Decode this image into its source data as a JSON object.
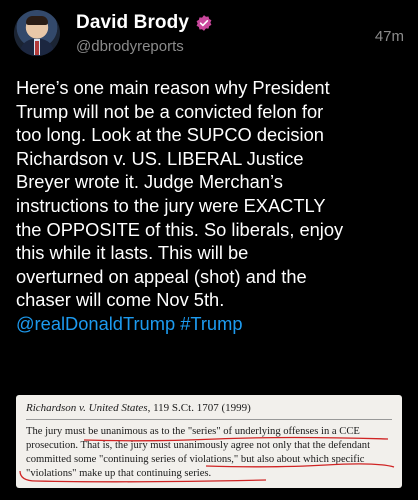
{
  "author": {
    "name": "David Brody",
    "handle": "@dbrodyreports",
    "time": "47m"
  },
  "post": {
    "text": "Here’s one main reason why President\nTrump will not be a convicted felon for\ntoo long. Look at the SUPCO decision\nRichardson v. US. LIBERAL Justice\nBreyer wrote it. Judge Merchan’s\ninstructions to the jury were EXACTLY\nthe OPPOSITE of this. So liberals, enjoy\nthis while it lasts. This will be\noverturned on appeal (shot) and the\nchaser will come Nov 5th.",
    "mentions": "@realDonaldTrump #Trump"
  },
  "attachment": {
    "case_name": "Richardson v. United States",
    "citation": ", 119 S.Ct. 1707 (1999)",
    "body": "The jury must be unanimous as to the \"series\" of underlying offenses in a CCE\nprosecution. That is, the jury must unanimously agree not only that the defendant\ncommitted some \"continuing series of violations,\" but also about which specific\n\"violations\" make up that continuing series."
  },
  "colors": {
    "background": "#000000",
    "link": "#1d9bf0",
    "verified_badge": "#c9479c",
    "underline": "#d02424"
  },
  "icons": {
    "badge": "verified-badge-icon"
  }
}
